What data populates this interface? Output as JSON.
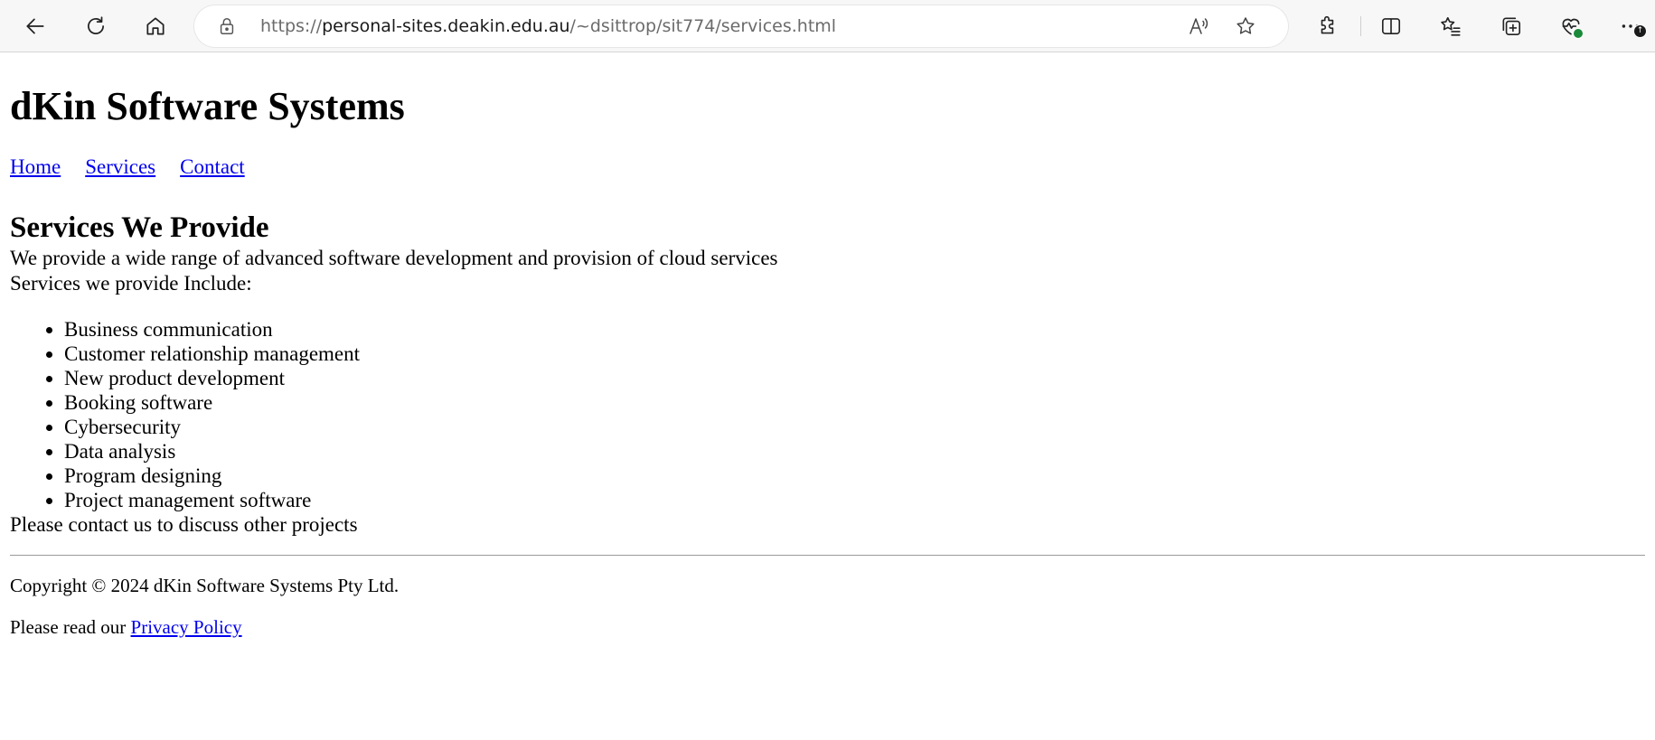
{
  "browser": {
    "url_prefix": "https://",
    "url_host": "personal-sites.deakin.edu.au",
    "url_path": "/~dsittrop/sit774/services.html",
    "icons": {
      "back": "back-arrow-icon",
      "refresh": "refresh-icon",
      "home": "home-icon",
      "lock": "lock-icon",
      "read_aloud": "read-aloud-icon",
      "favorite": "star-icon",
      "extensions": "puzzle-icon",
      "split_screen": "split-screen-icon",
      "favorites": "favorites-list-icon",
      "collections": "collections-icon",
      "browser_essentials": "heart-pulse-icon",
      "more": "more-icon"
    }
  },
  "site": {
    "title": "dKin Software Systems",
    "nav": [
      {
        "label": "Home"
      },
      {
        "label": "Services"
      },
      {
        "label": "Contact"
      }
    ]
  },
  "main": {
    "heading": "Services We Provide",
    "intro": "We provide a wide range of advanced software development and provision of cloud services",
    "list_label": "Services we provide Include:",
    "services": [
      "Business communication",
      "Customer relationship management",
      "New product development",
      "Booking software",
      "Cybersecurity",
      "Data analysis",
      "Program designing",
      "Project management software"
    ],
    "outro": "Please contact us to discuss other projects"
  },
  "footer": {
    "copyright": "Copyright © 2024 dKin Software Systems Pty Ltd.",
    "privacy_prefix": "Please read our ",
    "privacy_link": "Privacy Policy"
  },
  "colors": {
    "link": "#0000ee",
    "text": "#000000",
    "toolbar_bg": "#f7f7f7"
  }
}
